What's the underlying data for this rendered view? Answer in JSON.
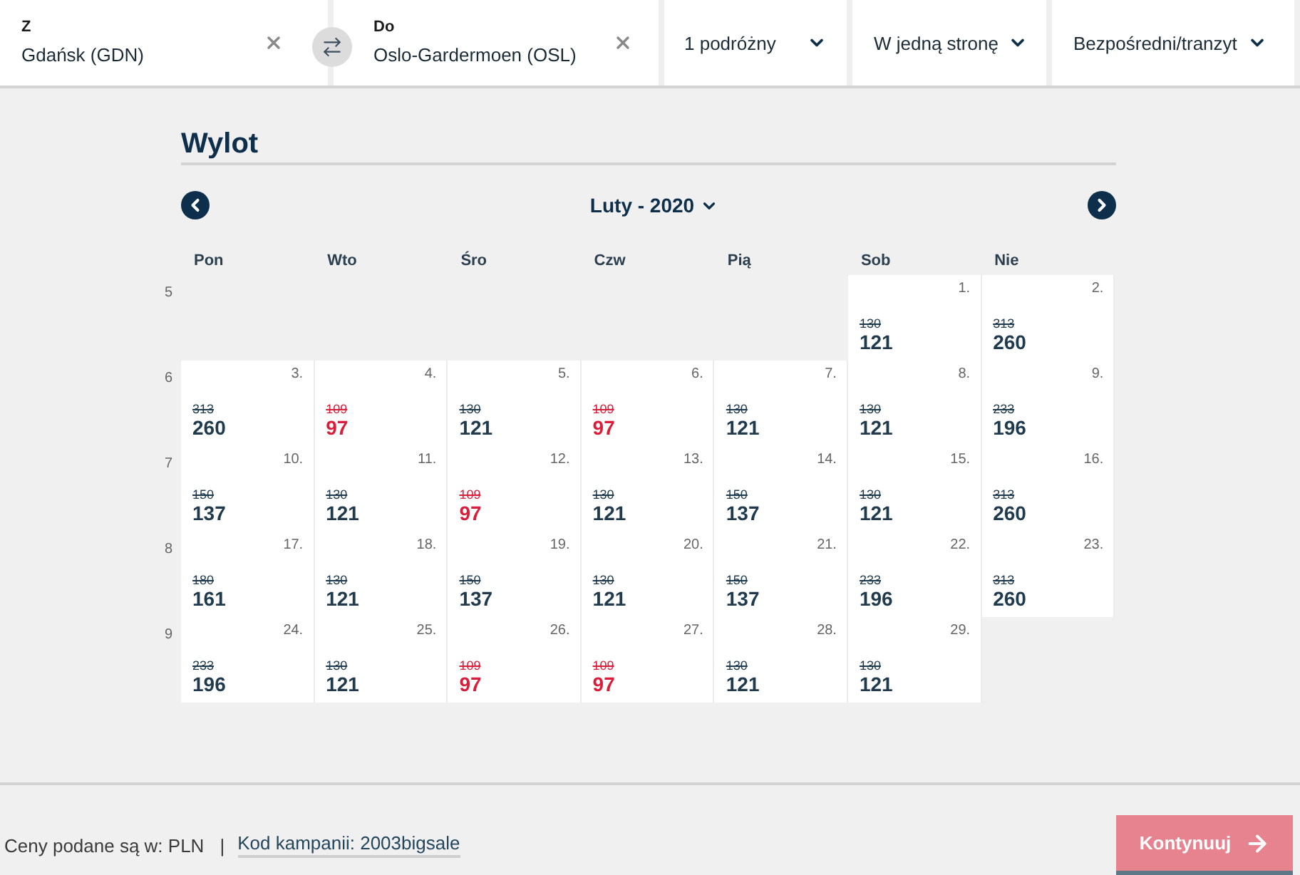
{
  "search_bar": {
    "origin": {
      "label": "Z",
      "value": "Gdańsk (GDN)"
    },
    "destination": {
      "label": "Do",
      "value": "Oslo-Gardermoen (OSL)"
    },
    "passengers": "1 podróżny",
    "trip_type": "W jedną stronę",
    "route_type": "Bezpośredni/tranzyt"
  },
  "calendar": {
    "title": "Wylot",
    "month": "Luty - 2020",
    "weekdays": [
      "Pon",
      "Wto",
      "Śro",
      "Czw",
      "Pią",
      "Sob",
      "Nie"
    ],
    "weeks": [
      {
        "number": "5",
        "days": [
          {
            "kind": "blank"
          },
          {
            "kind": "blank"
          },
          {
            "kind": "blank"
          },
          {
            "kind": "blank"
          },
          {
            "kind": "blank"
          },
          {
            "kind": "day",
            "date": "1.",
            "old_price": "130",
            "price": "121",
            "deal": false
          },
          {
            "kind": "day",
            "date": "2.",
            "old_price": "313",
            "price": "260",
            "deal": false
          }
        ]
      },
      {
        "number": "6",
        "days": [
          {
            "kind": "day",
            "date": "3.",
            "old_price": "313",
            "price": "260",
            "deal": false
          },
          {
            "kind": "day",
            "date": "4.",
            "old_price": "109",
            "price": "97",
            "deal": true
          },
          {
            "kind": "day",
            "date": "5.",
            "old_price": "130",
            "price": "121",
            "deal": false
          },
          {
            "kind": "day",
            "date": "6.",
            "old_price": "109",
            "price": "97",
            "deal": true
          },
          {
            "kind": "day",
            "date": "7.",
            "old_price": "130",
            "price": "121",
            "deal": false
          },
          {
            "kind": "day",
            "date": "8.",
            "old_price": "130",
            "price": "121",
            "deal": false
          },
          {
            "kind": "day",
            "date": "9.",
            "old_price": "233",
            "price": "196",
            "deal": false
          }
        ]
      },
      {
        "number": "7",
        "days": [
          {
            "kind": "day",
            "date": "10.",
            "old_price": "150",
            "price": "137",
            "deal": false
          },
          {
            "kind": "day",
            "date": "11.",
            "old_price": "130",
            "price": "121",
            "deal": false
          },
          {
            "kind": "day",
            "date": "12.",
            "old_price": "109",
            "price": "97",
            "deal": true
          },
          {
            "kind": "day",
            "date": "13.",
            "old_price": "130",
            "price": "121",
            "deal": false
          },
          {
            "kind": "day",
            "date": "14.",
            "old_price": "150",
            "price": "137",
            "deal": false
          },
          {
            "kind": "day",
            "date": "15.",
            "old_price": "130",
            "price": "121",
            "deal": false
          },
          {
            "kind": "day",
            "date": "16.",
            "old_price": "313",
            "price": "260",
            "deal": false
          }
        ]
      },
      {
        "number": "8",
        "days": [
          {
            "kind": "day",
            "date": "17.",
            "old_price": "180",
            "price": "161",
            "deal": false
          },
          {
            "kind": "day",
            "date": "18.",
            "old_price": "130",
            "price": "121",
            "deal": false
          },
          {
            "kind": "day",
            "date": "19.",
            "old_price": "150",
            "price": "137",
            "deal": false
          },
          {
            "kind": "day",
            "date": "20.",
            "old_price": "130",
            "price": "121",
            "deal": false
          },
          {
            "kind": "day",
            "date": "21.",
            "old_price": "150",
            "price": "137",
            "deal": false
          },
          {
            "kind": "day",
            "date": "22.",
            "old_price": "233",
            "price": "196",
            "deal": false
          },
          {
            "kind": "day",
            "date": "23.",
            "old_price": "313",
            "price": "260",
            "deal": false
          }
        ]
      },
      {
        "number": "9",
        "days": [
          {
            "kind": "day",
            "date": "24.",
            "old_price": "233",
            "price": "196",
            "deal": false
          },
          {
            "kind": "day",
            "date": "25.",
            "old_price": "130",
            "price": "121",
            "deal": false
          },
          {
            "kind": "day",
            "date": "26.",
            "old_price": "109",
            "price": "97",
            "deal": true
          },
          {
            "kind": "day",
            "date": "27.",
            "old_price": "109",
            "price": "97",
            "deal": true
          },
          {
            "kind": "day",
            "date": "28.",
            "old_price": "130",
            "price": "121",
            "deal": false
          },
          {
            "kind": "day",
            "date": "29.",
            "old_price": "130",
            "price": "121",
            "deal": false
          },
          {
            "kind": "blank"
          }
        ]
      }
    ]
  },
  "footer": {
    "currency_note": "Ceny podane są w: PLN",
    "separator": "|",
    "campaign_link": "Kod kampanii: 2003bigsale",
    "continue_button": "Kontynuuj"
  }
}
